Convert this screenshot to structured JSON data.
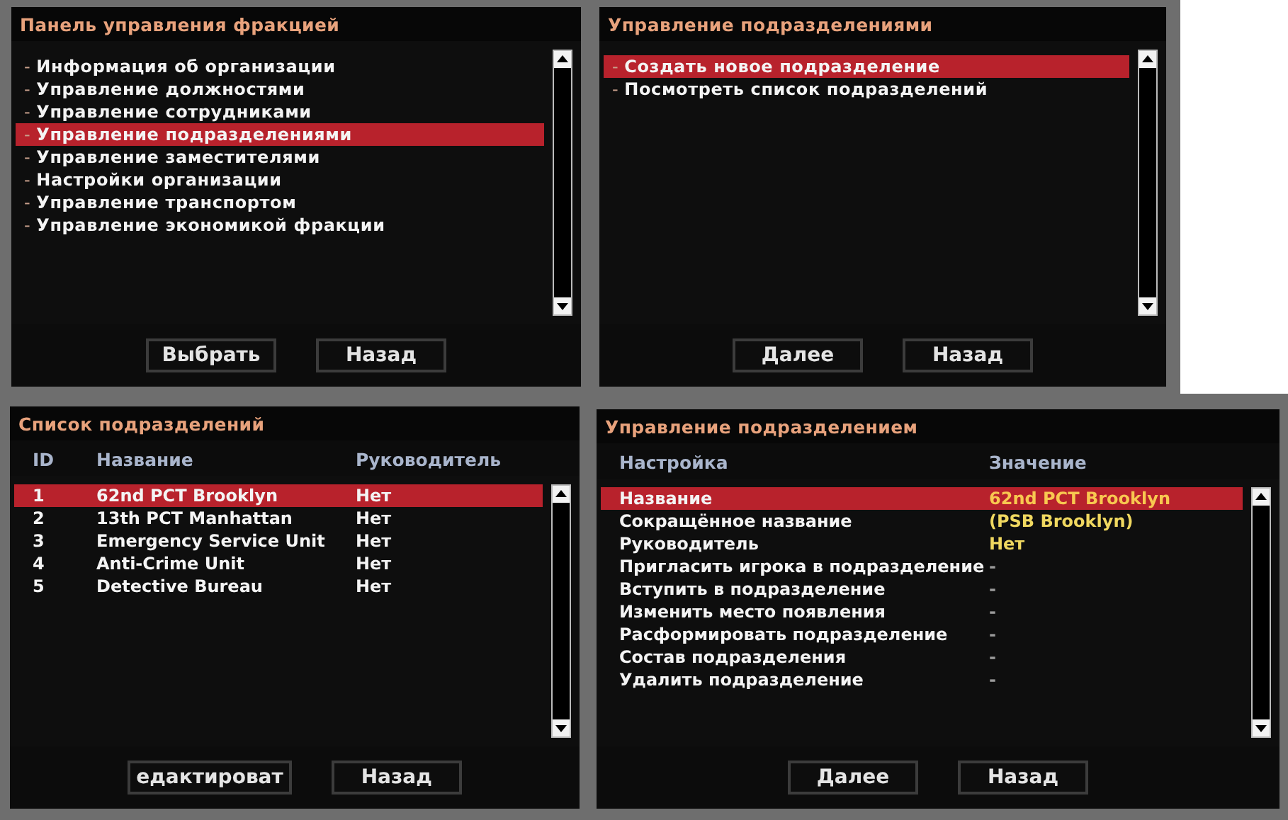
{
  "dialogs": [
    {
      "kind": "list",
      "title": "Панель управления фракцией",
      "items": [
        {
          "marker": "-",
          "label": "Информация об организации",
          "selected": false
        },
        {
          "marker": "-",
          "label": "Управление должностями",
          "selected": false
        },
        {
          "marker": "-",
          "label": "Управление сотрудниками",
          "selected": false
        },
        {
          "marker": "-",
          "label": "Управление подразделениями",
          "selected": true
        },
        {
          "marker": "-",
          "label": "Управление заместителями",
          "selected": false
        },
        {
          "marker": "-",
          "label": "Настройки организации",
          "selected": false
        },
        {
          "marker": "-",
          "label": "Управление транспортом",
          "selected": false
        },
        {
          "marker": "-",
          "label": "Управление экономикой фракции",
          "selected": false
        }
      ],
      "buttons": [
        "Выбрать",
        "Назад"
      ]
    },
    {
      "kind": "list",
      "title": "Управление подразделениями",
      "items": [
        {
          "marker": "-",
          "label": "Создать новое подразделение",
          "selected": true
        },
        {
          "marker": "-",
          "label": "Посмотреть список подразделений",
          "selected": false
        }
      ],
      "buttons": [
        "Далее",
        "Назад"
      ]
    },
    {
      "kind": "table",
      "title": "Список подразделений",
      "columns": [
        "ID",
        "Название",
        "Руководитель"
      ],
      "rows": [
        {
          "cells": [
            "1",
            "62nd PCT Brooklyn",
            "Нет"
          ],
          "selected": true
        },
        {
          "cells": [
            "2",
            "13th PCT Manhattan",
            "Нет"
          ],
          "selected": false
        },
        {
          "cells": [
            "3",
            "Emergency Service Unit",
            "Нет"
          ],
          "selected": false
        },
        {
          "cells": [
            "4",
            "Anti-Crime Unit",
            "Нет"
          ],
          "selected": false
        },
        {
          "cells": [
            "5",
            "Detective Bureau",
            "Нет"
          ],
          "selected": false
        }
      ],
      "buttons": [
        "едактироват",
        "Назад"
      ]
    },
    {
      "kind": "settings",
      "title": "Управление подразделением",
      "columns": [
        "Настройка",
        "Значение"
      ],
      "rows": [
        {
          "cells": [
            "Название",
            "62nd PCT Brooklyn"
          ],
          "selected": true,
          "muted": false
        },
        {
          "cells": [
            "Сокращённое название",
            "(PSB Brooklyn)"
          ],
          "selected": false,
          "muted": false
        },
        {
          "cells": [
            "Руководитель",
            "Нет"
          ],
          "selected": false,
          "muted": false
        },
        {
          "cells": [
            "Пригласить игрока в подразделение",
            "-"
          ],
          "selected": false,
          "muted": true
        },
        {
          "cells": [
            "Вступить в подразделение",
            "-"
          ],
          "selected": false,
          "muted": true
        },
        {
          "cells": [
            "Изменить место появления",
            "-"
          ],
          "selected": false,
          "muted": true
        },
        {
          "cells": [
            "Расформировать подразделение",
            "-"
          ],
          "selected": false,
          "muted": true
        },
        {
          "cells": [
            "Состав подразделения",
            "-"
          ],
          "selected": false,
          "muted": true
        },
        {
          "cells": [
            "Удалить подразделение",
            "-"
          ],
          "selected": false,
          "muted": true
        }
      ],
      "buttons": [
        "Далее",
        "Назад"
      ]
    }
  ]
}
